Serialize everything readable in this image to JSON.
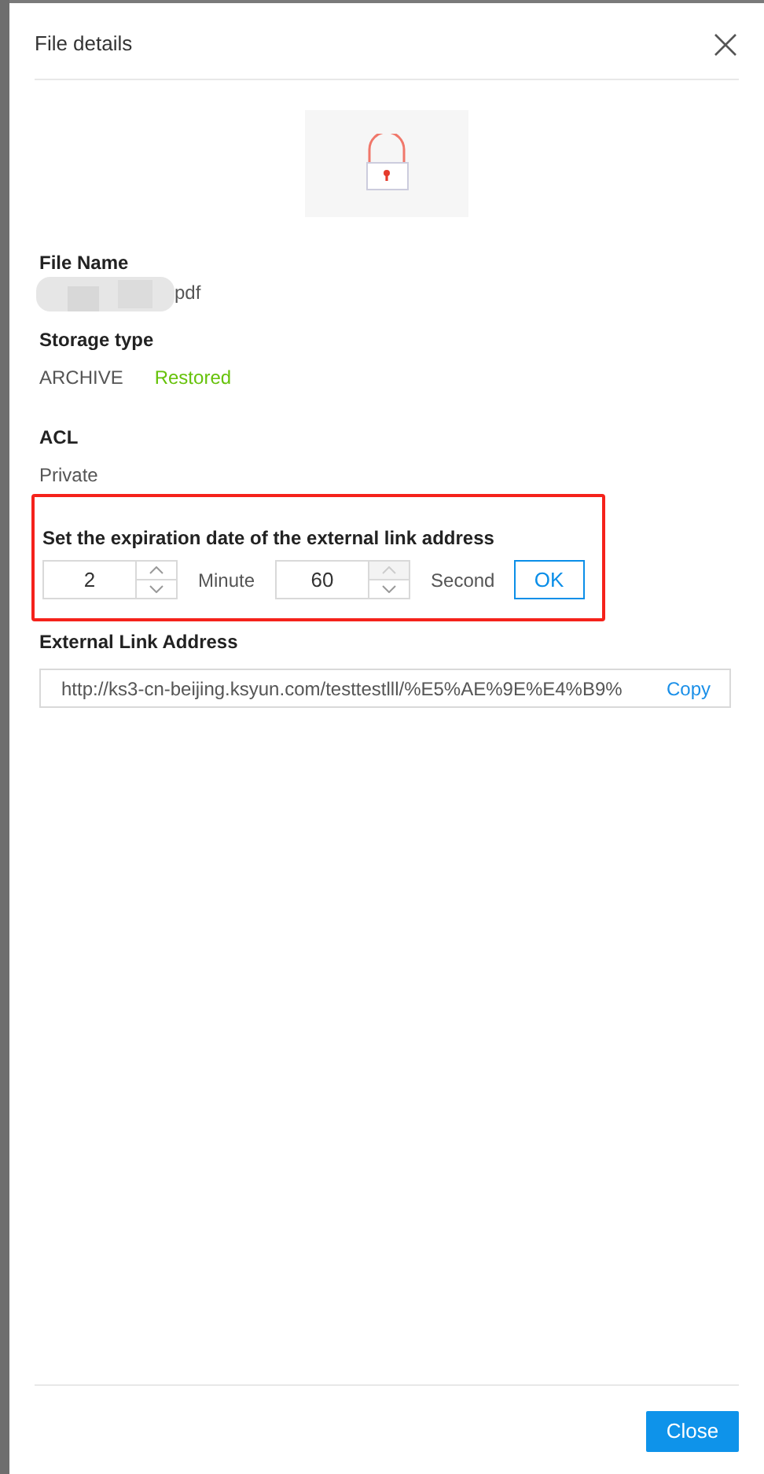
{
  "dialog": {
    "title": "File details"
  },
  "file_name": {
    "label": "File Name",
    "value": "pdf"
  },
  "storage_type": {
    "label": "Storage type",
    "value": "ARCHIVE",
    "status": "Restored"
  },
  "acl": {
    "label": "ACL",
    "value": "Private"
  },
  "expiration": {
    "label": "Set the expiration date of the external link address",
    "highlighted": true,
    "fields": [
      {
        "value": "2",
        "unit": "Minute",
        "up_disabled": false
      },
      {
        "value": "60",
        "unit": "Second",
        "up_disabled": true
      }
    ],
    "ok_button": "OK"
  },
  "external_link": {
    "label": "External Link Address",
    "value": "http://ks3-cn-beijing.ksyun.com/testtestlll/%E5%AE%9E%E4%B9%",
    "copy": "Copy"
  },
  "footer": {
    "close_button": "Close"
  }
}
